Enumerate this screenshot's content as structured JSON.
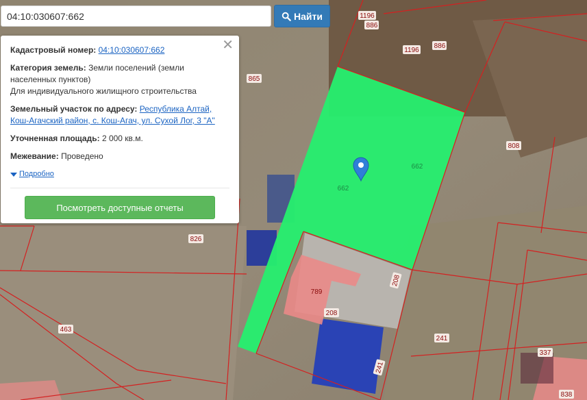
{
  "search": {
    "value": "04:10:030607:662",
    "button_label": "Найти"
  },
  "panel": {
    "cadastral_label": "Кадастровый номер:",
    "cadastral_value": "04:10:030607:662",
    "category_label": "Категория земель:",
    "category_value": "Земли поселений (земли населенных пунктов)",
    "category_use": "Для индивидуального жилищного строительства",
    "address_label": "Земельный участок по адресу:",
    "address_value": "Республика Алтай, Кош-Агачский район, с. Кош-Агач, ул. Сухой Лог, 3 \"А\"",
    "area_label": "Уточненная площадь:",
    "area_value": "2 000 кв.м.",
    "survey_label": "Межевание:",
    "survey_value": "Проведено",
    "details_link": "Подробно",
    "reports_button": "Посмотреть доступные отчеты"
  },
  "map": {
    "parcel_labels": [
      "1196",
      "886",
      "1196",
      "886",
      "865",
      "808",
      "662",
      "662",
      "826",
      "789",
      "208",
      "208",
      "463",
      "241",
      "241",
      "337",
      "838"
    ],
    "colors": {
      "selected_parcel": "#27ee6e",
      "boundary": "#d42020",
      "building": "#e8888a",
      "marker": "#2f7fd8"
    },
    "icons": [
      "map-marker-icon",
      "search-icon",
      "close-icon",
      "caret-down-icon"
    ]
  }
}
